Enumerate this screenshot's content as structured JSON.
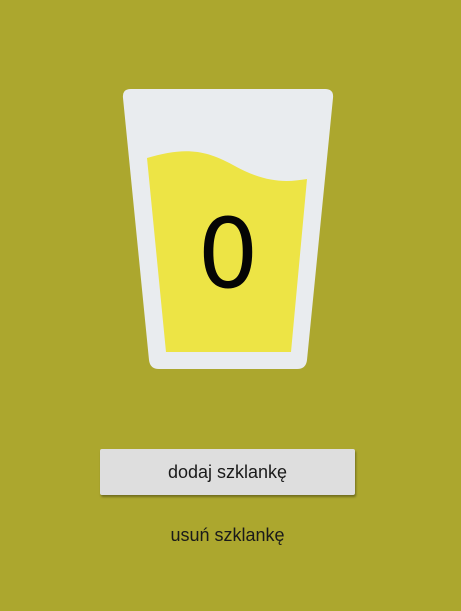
{
  "glass": {
    "count": "0"
  },
  "actions": {
    "add_label": "dodaj szklankę",
    "remove_label": "usuń szklankę"
  },
  "colors": {
    "background": "#aca72e",
    "glass": "#e9ecef",
    "water": "#ede445",
    "text": "#050505",
    "button": "#dedede"
  }
}
